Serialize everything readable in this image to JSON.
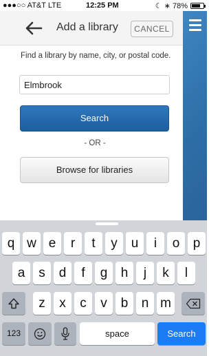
{
  "status_bar": {
    "carrier": "●●●○○ AT&T  LTE",
    "time": "12:25 PM",
    "battery_text": "☾ ∗ 78%",
    "battery_level": 0.78
  },
  "header": {
    "title": "Add a library",
    "cancel_label": "CANCEL"
  },
  "form": {
    "find_label": "Find a library by name, city, or postal code.",
    "search_value": "Elmbrook",
    "search_button": "Search",
    "or_text": "- OR -",
    "browse_button": "Browse for libraries"
  },
  "keyboard": {
    "row1": [
      "q",
      "w",
      "e",
      "r",
      "t",
      "y",
      "u",
      "i",
      "o",
      "p"
    ],
    "row2": [
      "a",
      "s",
      "d",
      "f",
      "g",
      "h",
      "j",
      "k",
      "l"
    ],
    "row3": [
      "z",
      "x",
      "c",
      "v",
      "b",
      "n",
      "m"
    ],
    "numbers_key": "123",
    "space_key": "space",
    "search_key": "Search",
    "icons": [
      "shift-icon",
      "backspace-icon",
      "emoji-icon",
      "microphone-icon"
    ]
  },
  "colors": {
    "accent_blue": "#1e5e9e",
    "panel_blue": "#2e6fa7",
    "keyboard_bg": "#d1d4d9",
    "search_key": "#1b7cf6"
  }
}
